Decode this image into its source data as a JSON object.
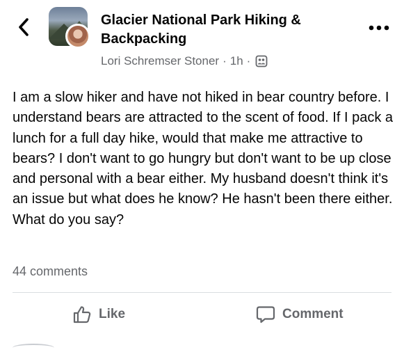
{
  "header": {
    "back_icon": "chevron-left-icon",
    "group_name": "Glacier National Park Hiking & Backpacking",
    "author": "Lori Schremser Stoner",
    "separator": "·",
    "time": "1h",
    "audience_icon": "group-audience-icon",
    "more_icon": "more-horizontal-icon"
  },
  "post": {
    "text": "I am a slow hiker and have not hiked in bear country before. I understand bears are attracted to the scent of food. If I pack a lunch for a full day hike, would that make me attractive to bears? I don't want to go hungry but don't want to be up close and personal with a bear either. My husband doesn't think it's an issue but what does he know? He hasn't been there either. What do you say?"
  },
  "stats": {
    "comments": "44 comments"
  },
  "actions": {
    "like_label": "Like",
    "like_icon": "thumbs-up-icon",
    "comment_label": "Comment",
    "comment_icon": "speech-bubble-icon"
  },
  "colors": {
    "text": "#050505",
    "secondary": "#65676b",
    "divider": "#dadde1"
  }
}
